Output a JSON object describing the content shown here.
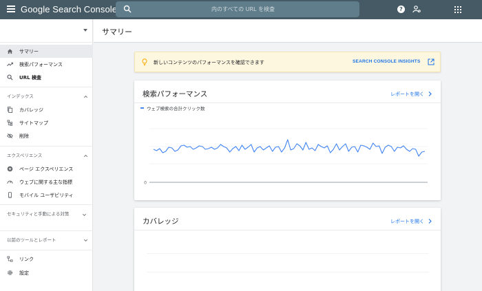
{
  "header": {
    "logo_text": "Google Search Console",
    "search_placeholder": "内のすべての URL を検査"
  },
  "sidebar": {
    "main_items": [
      {
        "label": "サマリー",
        "icon": "home-icon",
        "active": true
      },
      {
        "label": "検索パフォーマンス",
        "icon": "trending-up-icon"
      },
      {
        "label": "URL 検査",
        "icon": "search-icon"
      }
    ],
    "sections": [
      {
        "title": "インデックス",
        "items": [
          {
            "label": "カバレッジ",
            "icon": "file-copy-icon"
          },
          {
            "label": "サイトマップ",
            "icon": "sitemap-icon"
          },
          {
            "label": "削除",
            "icon": "eye-off-icon"
          }
        ]
      },
      {
        "title": "エクスペリエンス",
        "items": [
          {
            "label": "ページ エクスペリエンス",
            "icon": "add-circle-icon"
          },
          {
            "label": "ウェブに関する主な指標",
            "icon": "speed-icon"
          },
          {
            "label": "モバイル ユーザビリティ",
            "icon": "smartphone-icon"
          }
        ]
      }
    ],
    "collapsed_sections": [
      {
        "title": "セキュリティと手動による対策"
      },
      {
        "title": "以前のツールとレポート"
      }
    ],
    "bottom_items": [
      {
        "label": "リンク",
        "icon": "links-icon"
      },
      {
        "label": "設定",
        "icon": "gear-icon"
      }
    ]
  },
  "page": {
    "title": "サマリー"
  },
  "banner": {
    "text": "新しいコンテンツのパフォーマンスを確認できます",
    "link": "SEARCH CONSOLE INSIGHTS"
  },
  "performance_card": {
    "title": "検索パフォーマンス",
    "link": "レポートを開く",
    "legend": "ウェブ検索の合計クリック数"
  },
  "coverage_card": {
    "title": "カバレッジ",
    "link": "レポートを開く"
  },
  "colors": {
    "topbar": "#455a64",
    "accent": "#1a73e8",
    "series": "#4285f4",
    "banner_bg": "#fef7e0"
  },
  "chart_data": {
    "type": "line",
    "series": [
      {
        "name": "ウェブ検索の合計クリック数",
        "values": [
          48,
          46,
          49,
          43,
          45,
          51,
          50,
          45,
          47,
          53,
          54,
          51,
          52,
          48,
          50,
          53,
          52,
          48,
          49,
          51,
          48,
          50,
          55,
          52,
          50,
          44,
          49,
          52,
          46,
          54,
          48,
          51,
          55,
          44,
          50,
          52,
          47,
          50,
          53,
          45,
          51,
          52,
          44,
          50,
          62,
          47,
          49,
          56,
          53,
          47,
          58,
          48,
          50,
          46,
          55,
          52,
          50,
          53,
          43,
          48,
          56,
          47,
          52,
          56,
          45,
          51,
          52,
          44,
          54,
          53,
          51,
          48,
          57,
          52,
          53,
          42,
          51,
          54,
          52,
          45,
          51,
          50,
          53,
          48,
          45,
          49,
          48,
          38,
          44,
          45
        ]
      }
    ],
    "y_ticks": [
      "0"
    ],
    "ylim": [
      0,
      100
    ],
    "grid": true,
    "legend": "top-left"
  }
}
